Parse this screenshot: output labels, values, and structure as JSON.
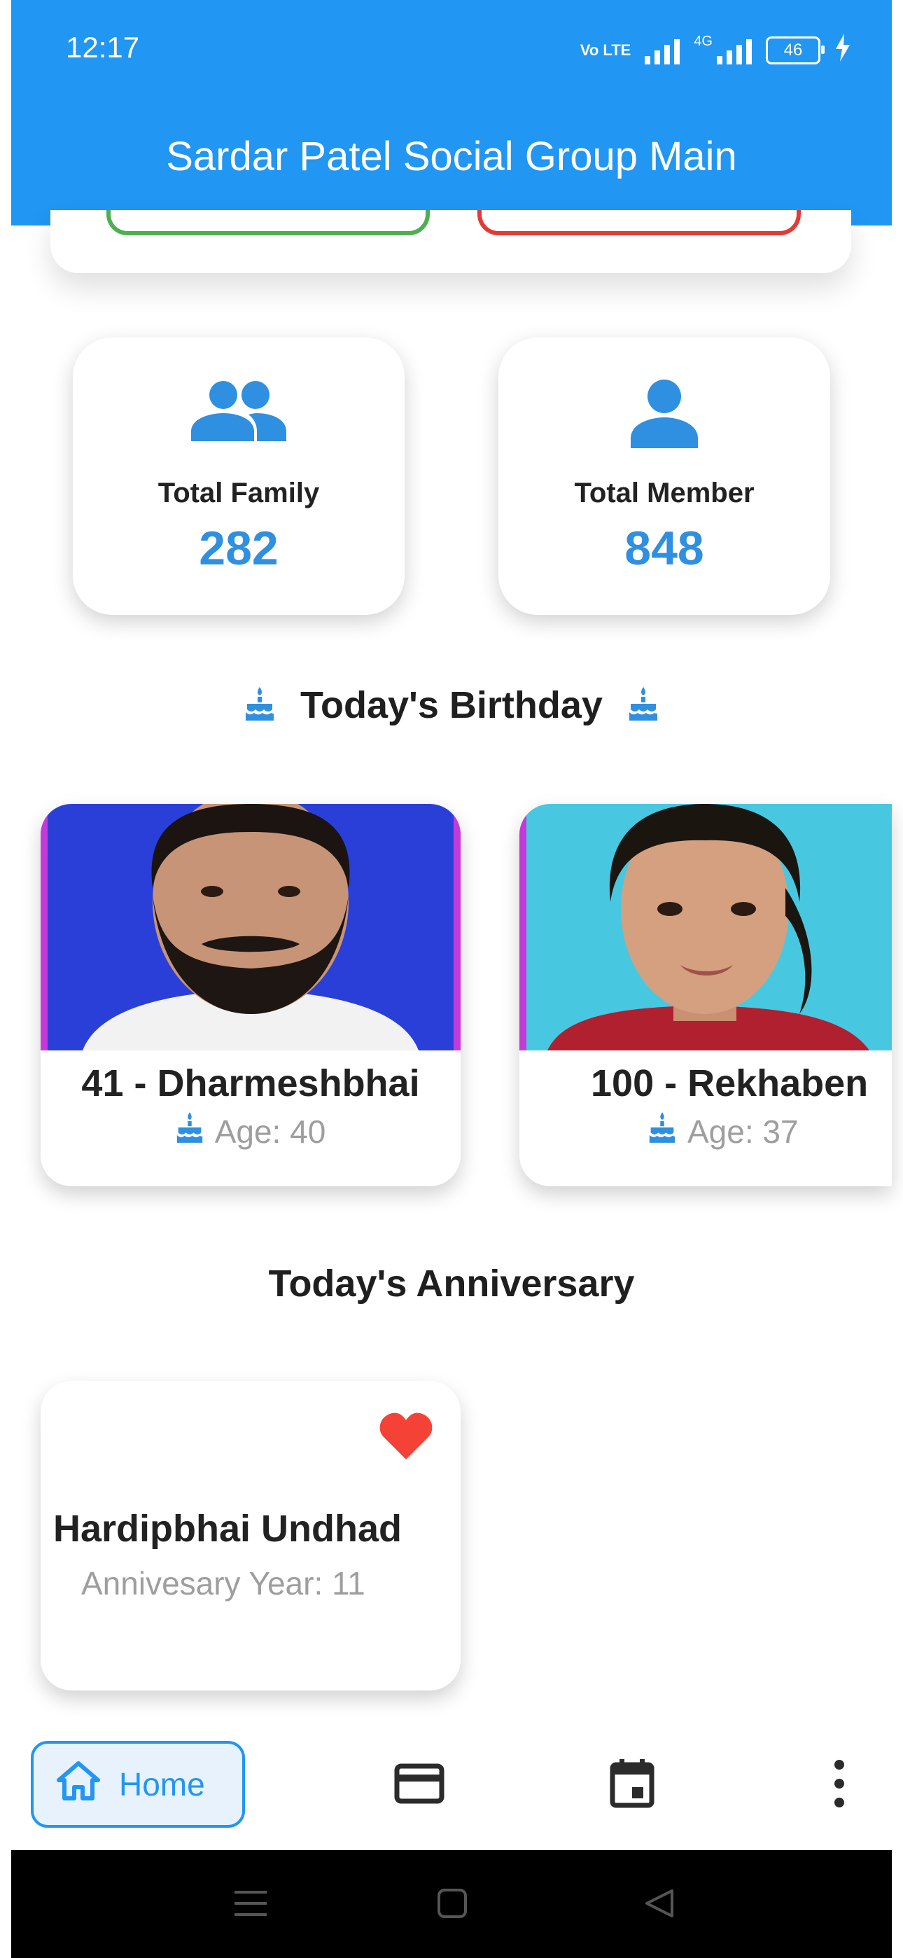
{
  "status_bar": {
    "time": "12:17",
    "network_label": "4G",
    "volte_label": "Vo LTE",
    "battery": "46"
  },
  "app_bar": {
    "title": "Sardar Patel Social Group Main"
  },
  "stats": {
    "family": {
      "label": "Total Family",
      "value": "282",
      "icon": "people-icon"
    },
    "member": {
      "label": "Total Member",
      "value": "848",
      "icon": "person-icon"
    }
  },
  "birthday": {
    "heading": "Today's Birthday",
    "icon": "cake-icon",
    "cards": [
      {
        "name": "41 - Dharmeshbhai",
        "age": "Age: 40"
      },
      {
        "name": "100 - Rekhaben",
        "age": "Age: 37"
      }
    ]
  },
  "anniversary": {
    "heading": "Today's Anniversary",
    "cards": [
      {
        "name": "Hardipbhai Undhad",
        "year": "Annivesary Year: 11",
        "icon": "heart-icon"
      }
    ]
  },
  "bottom_nav": {
    "home_label": "Home",
    "items": [
      "home-icon",
      "card-icon",
      "calendar-icon",
      "more-vert-icon"
    ]
  },
  "colors": {
    "primary": "#2196f3",
    "value_blue": "#2f8fe0",
    "heart": "#f44336",
    "muted": "#9e9e9e"
  }
}
